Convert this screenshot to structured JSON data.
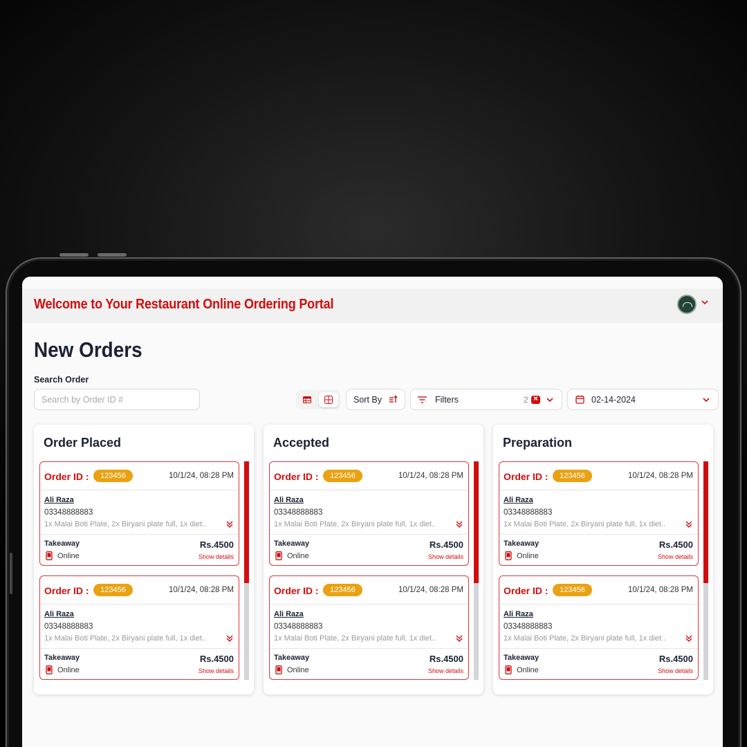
{
  "header": {
    "title": "Welcome to Your Restaurant Online Ordering Portal",
    "avatar_icon": "restaurant-logo-avatar"
  },
  "page": {
    "title": "New Orders"
  },
  "search": {
    "label": "Search Order",
    "placeholder": "Search by Order ID #",
    "value": ""
  },
  "toolbar": {
    "view_modes": [
      "list-view",
      "grid-view"
    ],
    "active_view": "grid-view",
    "sort_label": "Sort By",
    "filters_label": "Filters",
    "filters_count": "2",
    "date": "02-14-2024"
  },
  "colors": {
    "accent": "#d20d0d",
    "badge": "#eaa213",
    "text": "#1b2233"
  },
  "columns": [
    {
      "title": "Order Placed",
      "orders": [
        {
          "label": "Order ID :",
          "id": "123456",
          "time": "10/1/24, 08:28 PM",
          "customer": "Ali Raza",
          "phone": "03348888883",
          "items": "1x Malai Boti Plate, 2x Biryani plate full, 1x diet..",
          "type": "Takeaway",
          "payment": "Online",
          "total": "Rs.4500",
          "details": "Show details"
        },
        {
          "label": "Order ID :",
          "id": "123456",
          "time": "10/1/24, 08:28 PM",
          "customer": "Ali Raza",
          "phone": "03348888883",
          "items": "1x Malai Boti Plate, 2x Biryani plate full, 1x diet..",
          "type": "Takeaway",
          "payment": "Online",
          "total": "Rs.4500",
          "details": "Show details"
        }
      ]
    },
    {
      "title": "Accepted",
      "orders": [
        {
          "label": "Order ID :",
          "id": "123456",
          "time": "10/1/24, 08:28 PM",
          "customer": "Ali Raza",
          "phone": "03348888883",
          "items": "1x Malai Boti Plate, 2x Biryani plate full, 1x diet..",
          "type": "Takeaway",
          "payment": "Online",
          "total": "Rs.4500",
          "details": "Show details"
        },
        {
          "label": "Order ID :",
          "id": "123456",
          "time": "10/1/24, 08:28 PM",
          "customer": "Ali Raza",
          "phone": "03348888883",
          "items": "1x Malai Boti Plate, 2x Biryani plate full, 1x diet..",
          "type": "Takeaway",
          "payment": "Online",
          "total": "Rs.4500",
          "details": "Show details"
        }
      ]
    },
    {
      "title": "Preparation",
      "orders": [
        {
          "label": "Order ID :",
          "id": "123456",
          "time": "10/1/24, 08:28 PM",
          "customer": "Ali Raza",
          "phone": "03348888883",
          "items": "1x Malai Boti Plate, 2x Biryani plate full, 1x diet..",
          "type": "Takeaway",
          "payment": "Online",
          "total": "Rs.4500",
          "details": "Show details"
        },
        {
          "label": "Order ID :",
          "id": "123456",
          "time": "10/1/24, 08:28 PM",
          "customer": "Ali Raza",
          "phone": "03348888883",
          "items": "1x Malai Boti Plate, 2x Biryani plate full, 1x diet..",
          "type": "Takeaway",
          "payment": "Online",
          "total": "Rs.4500",
          "details": "Show details"
        }
      ]
    }
  ]
}
